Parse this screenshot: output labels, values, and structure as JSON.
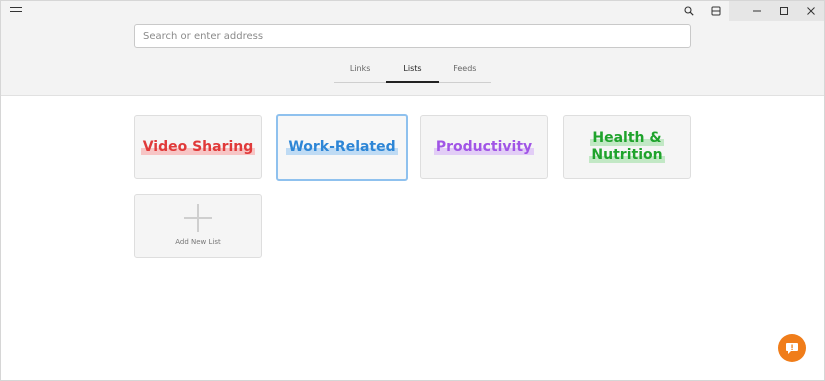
{
  "window": {
    "menu_icon": "hamburger-icon",
    "toolbar_icons": [
      "search-icon",
      "reading-view-icon"
    ],
    "caption_icons": [
      "minimize-icon",
      "maximize-icon",
      "close-icon"
    ]
  },
  "search": {
    "placeholder": "Search or enter address"
  },
  "tabs": [
    {
      "label": "Links",
      "active": false
    },
    {
      "label": "Lists",
      "active": true
    },
    {
      "label": "Feeds",
      "active": false
    }
  ],
  "lists": [
    {
      "label_line1": "Video Sharing",
      "label_line2": "",
      "color": "#e03a3a",
      "highlight": "#f7c5c5",
      "selected": false
    },
    {
      "label_line1": "Work-Related",
      "label_line2": "",
      "color": "#2e86d6",
      "highlight": "#bfdbf4",
      "selected": true
    },
    {
      "label_line1": "Productivity",
      "label_line2": "",
      "color": "#a155e6",
      "highlight": "#e2cdf6",
      "selected": false
    },
    {
      "label_line1": "Health &",
      "label_line2": "Nutrition",
      "color": "#1fa32c",
      "highlight": "#c2e8c5",
      "selected": false
    }
  ],
  "add_card": {
    "label": "Add New List",
    "icon": "plus-icon"
  },
  "fab": {
    "icon": "feedback-icon",
    "color": "#f07d1a"
  }
}
